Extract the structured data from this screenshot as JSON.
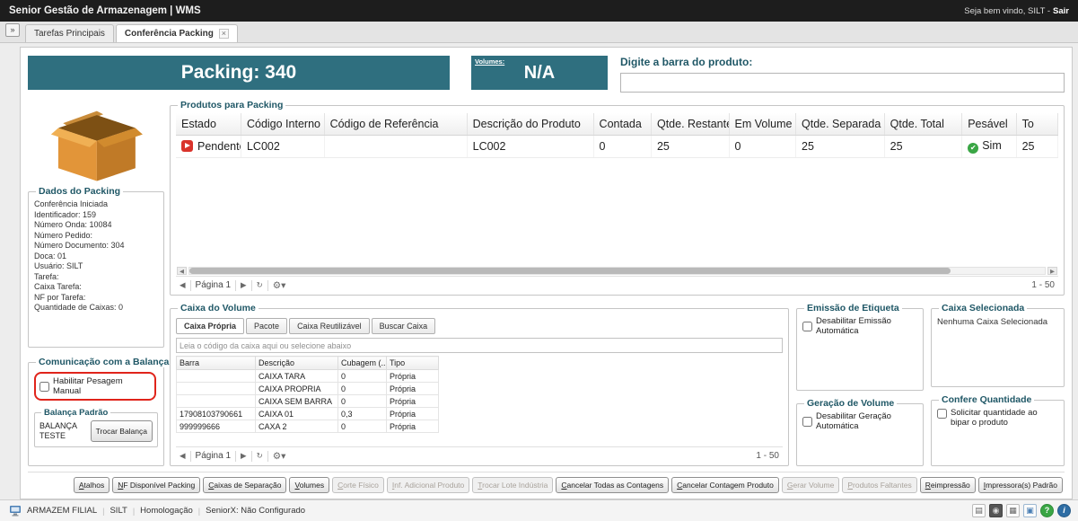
{
  "colors": {
    "accent_teal": "#2f6f7f",
    "section_title_teal": "#1f5766",
    "annotation_red": "#e0241b",
    "pending_red": "#d9332b",
    "ok_green": "#3aa645"
  },
  "titlebar": {
    "title": "Senior Gestão de Armazenagem | WMS",
    "welcome": "Seja bem vindo, SILT -",
    "logout": "Sair"
  },
  "tabbar": {
    "expand_button": "»",
    "tabs": [
      {
        "label": "Tarefas Principais"
      },
      {
        "label": "Conferência Packing",
        "close": "×"
      }
    ]
  },
  "header": {
    "packing": "Packing: 340",
    "volumes_label": "Volumes:",
    "volumes_value": "N/A",
    "barcode_label": "Digite a barra do produto:",
    "barcode_value": ""
  },
  "dados_packing": {
    "title": "Dados do Packing",
    "lines": [
      "Conferência Iniciada",
      "Identificador: 159",
      "Número Onda: 10084",
      "Número Pedido:",
      "Número Documento: 304",
      "Doca: 01",
      "Usuário: SILT",
      "Tarefa:",
      "Caixa Tarefa:",
      "NF por Tarefa:",
      "Quantidade de Caixas: 0"
    ]
  },
  "balanca": {
    "title": "Comunicação com a Balança",
    "manual_checkbox": "Habilitar Pesagem Manual",
    "default_group": "Balança Padrão",
    "scale_name": "BALANÇA TESTE",
    "change_button": "Trocar Balança"
  },
  "produtos": {
    "title": "Produtos para Packing",
    "columns": [
      "Estado",
      "Código Interno",
      "Código de Referência",
      "Descrição do Produto",
      "Contada",
      "Qtde. Restante",
      "Em Volume",
      "Qtde. Separada",
      "Qtde. Total",
      "Pesável",
      "To"
    ],
    "rows": [
      {
        "estado": "Pendente",
        "codigo_interno": "LC002",
        "codigo_referencia": "",
        "descricao": "LC002",
        "contada": "0",
        "qtde_restante": "25",
        "em_volume": "0",
        "qtde_separada": "25",
        "qtde_total": "25",
        "pesavel": "Sim",
        "total": "25"
      }
    ],
    "pager": {
      "page": "Página 1",
      "range": "1 - 50"
    }
  },
  "caixa": {
    "title": "Caixa do Volume",
    "tabs": [
      "Caixa Própria",
      "Pacote",
      "Caixa Reutilizável",
      "Buscar Caixa"
    ],
    "hint": "Leia o código da caixa aqui ou selecione abaixo",
    "columns": [
      "Barra",
      "Descrição",
      "Cubagem (...",
      "Tipo"
    ],
    "rows": [
      {
        "barra": "",
        "descricao": "CAIXA TARA",
        "cubagem": "0",
        "tipo": "Própria"
      },
      {
        "barra": "",
        "descricao": "CAIXA PROPRIA",
        "cubagem": "0",
        "tipo": "Própria"
      },
      {
        "barra": "",
        "descricao": "CAIXA SEM BARRA",
        "cubagem": "0",
        "tipo": "Própria"
      },
      {
        "barra": "17908103790661",
        "descricao": "CAIXA 01",
        "cubagem": "0,3",
        "tipo": "Própria"
      },
      {
        "barra": "999999666",
        "descricao": "CAXA 2",
        "cubagem": "0",
        "tipo": "Própria"
      }
    ],
    "pager": {
      "page": "Página 1",
      "range": "1 - 50"
    }
  },
  "panels": {
    "emissao": {
      "title": "Emissão de Etiqueta",
      "checkbox": "Desabilitar Emissão Automática"
    },
    "geracao": {
      "title": "Geração de Volume",
      "checkbox": "Desabilitar Geração Automática"
    },
    "selecionada": {
      "title": "Caixa Selecionada",
      "text": "Nenhuma Caixa Selecionada"
    },
    "confere": {
      "title": "Confere Quantidade",
      "checkbox": "Solicitar quantidade ao bipar o produto"
    }
  },
  "bottom_buttons": [
    {
      "label": "Atalhos",
      "enabled": true
    },
    {
      "label": "NF Disponível Packing",
      "enabled": true
    },
    {
      "label": "Caixas de Separação",
      "enabled": true
    },
    {
      "label": "Volumes",
      "enabled": true
    },
    {
      "label": "Corte Físico",
      "enabled": false
    },
    {
      "label": "Inf. Adicional Produto",
      "enabled": false
    },
    {
      "label": "Trocar Lote Indústria",
      "enabled": false
    },
    {
      "label": "Cancelar Todas as Contagens",
      "enabled": true
    },
    {
      "label": "Cancelar Contagem Produto",
      "enabled": true
    },
    {
      "label": "Gerar Volume",
      "enabled": false
    },
    {
      "label": "Produtos Faltantes",
      "enabled": false
    },
    {
      "label": "Reimpressão",
      "enabled": true
    },
    {
      "label": "Impressora(s) Padrão",
      "enabled": true
    }
  ],
  "statusbar": {
    "segments": [
      "ARMAZEM FILIAL",
      "SILT",
      "Homologação",
      "SeniorX: Não Configurado"
    ],
    "icons": [
      {
        "name": "report-icon",
        "glyph": "▤"
      },
      {
        "name": "camera-icon",
        "glyph": "◉"
      },
      {
        "name": "printer-icon",
        "glyph": "▦"
      },
      {
        "name": "monitor-icon",
        "glyph": "▣"
      },
      {
        "name": "help-icon",
        "glyph": "?"
      },
      {
        "name": "info-icon",
        "glyph": "i"
      }
    ]
  }
}
